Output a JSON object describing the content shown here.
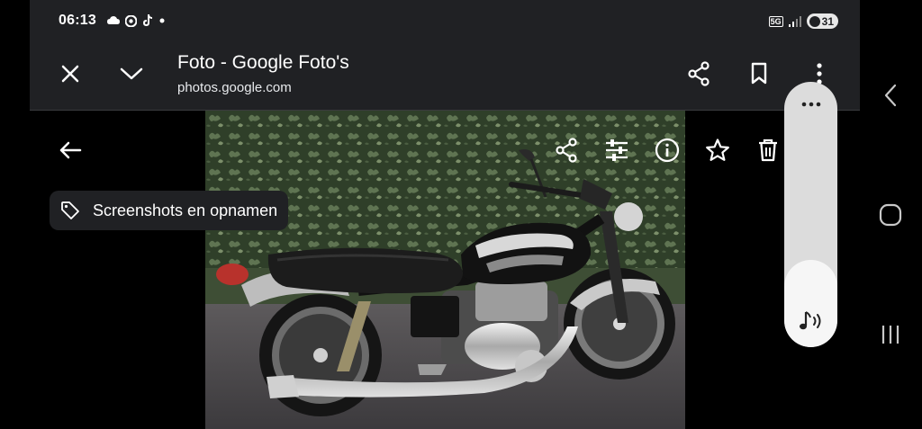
{
  "status_bar": {
    "time": "06:13",
    "network": "5G",
    "battery": "31"
  },
  "custom_tab": {
    "title": "Foto - Google Foto's",
    "url": "photos.google.com"
  },
  "viewer": {
    "album_chip_label": "Screenshots en opnamen"
  },
  "volume": {
    "level": 0.33
  },
  "colors": {
    "toolbar_bg": "#202124",
    "chip_bg": "#202124",
    "volume_track": "#dcdcdc",
    "volume_fill": "#f6f6f6"
  }
}
